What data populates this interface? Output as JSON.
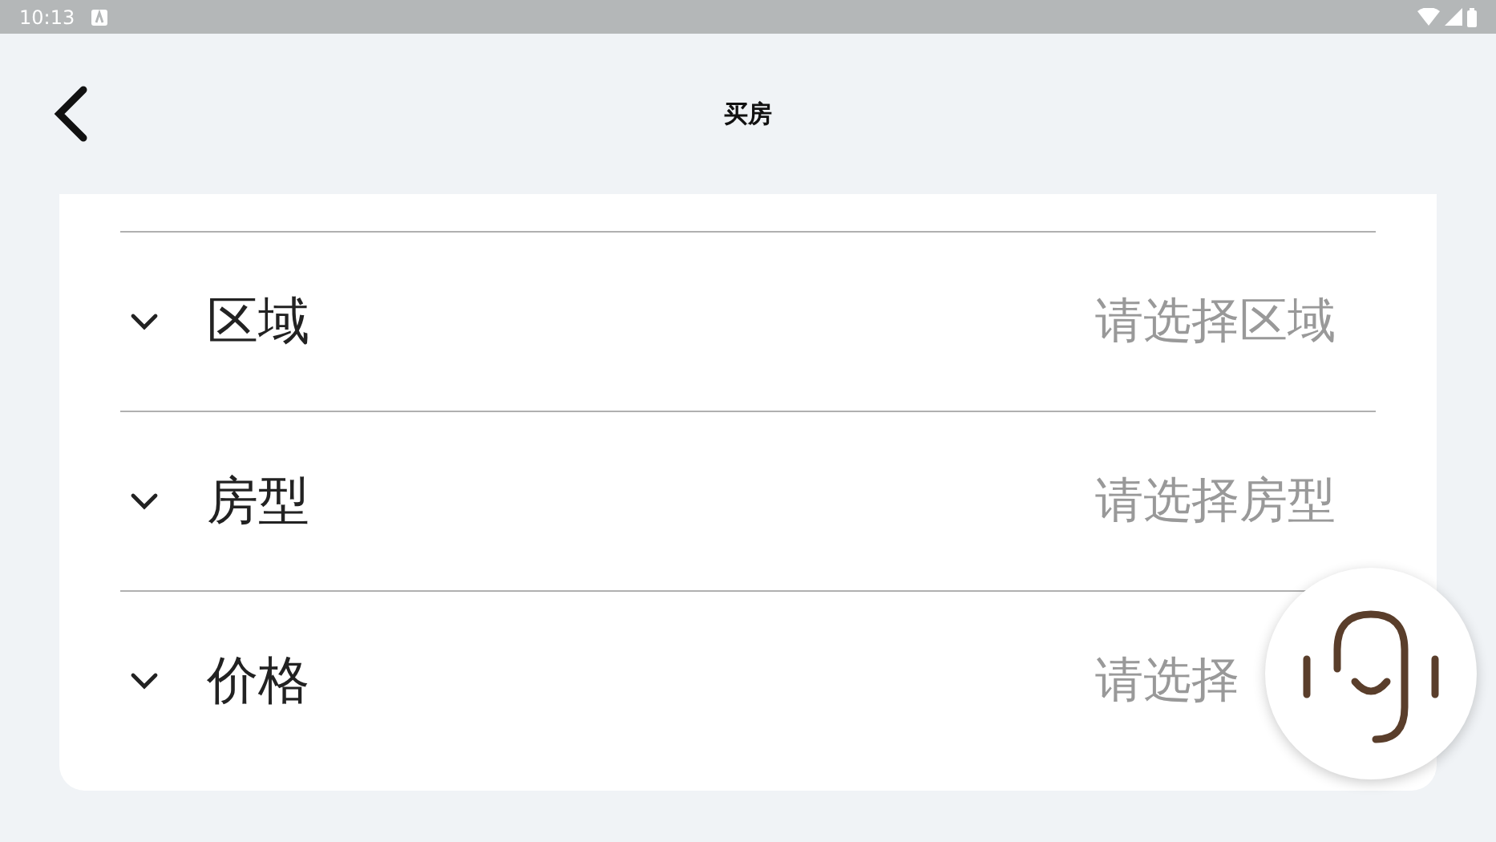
{
  "status_bar": {
    "time": "10:13"
  },
  "header": {
    "title": "买房"
  },
  "filters": [
    {
      "label": "区域",
      "placeholder": "请选择区域",
      "expanded": false
    },
    {
      "label": "房型",
      "placeholder": "请选择房型",
      "expanded": false
    },
    {
      "label": "价格",
      "placeholder": "请选择",
      "expanded": false
    }
  ]
}
